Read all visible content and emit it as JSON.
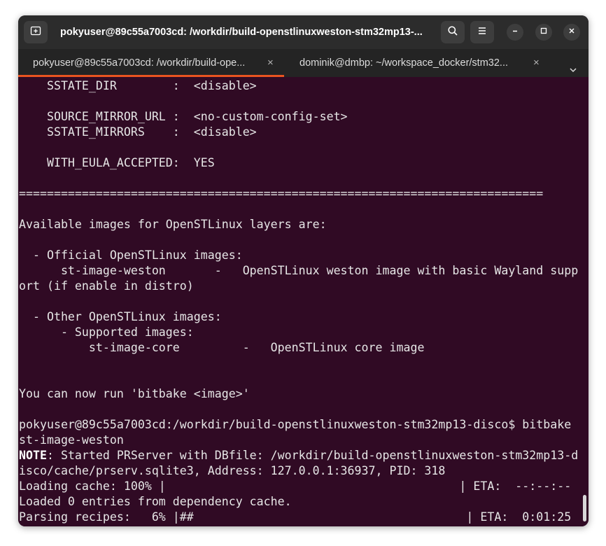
{
  "window": {
    "title": "pokyuser@89c55a7003cd: /workdir/build-openstlinuxweston-stm32mp13-..."
  },
  "tabs": [
    {
      "label": "pokyuser@89c55a7003cd: /workdir/build-ope...",
      "close": "×",
      "active": true
    },
    {
      "label": "dominik@dmbp: ~/workspace_docker/stm32...",
      "close": "×",
      "active": false
    }
  ],
  "icons": {
    "new_tab": "new-tab-icon",
    "search": "search-icon",
    "menu": "hamburger-menu-icon",
    "minimize": "minimize-icon",
    "maximize": "maximize-icon",
    "close": "close-icon",
    "tabs_dropdown": "chevron-down-icon"
  },
  "colors": {
    "terminal_bg": "#300a24",
    "titlebar_bg": "#2c2c2c",
    "tabbar_bg": "#242424",
    "active_tab_accent": "#e95420",
    "text": "#e6e6e6"
  },
  "terminal": {
    "lines": [
      "    SSTATE_DIR        :  <disable>",
      "",
      "    SOURCE_MIRROR_URL :  <no-custom-config-set>",
      "    SSTATE_MIRRORS    :  <disable>",
      "",
      "    WITH_EULA_ACCEPTED:  YES",
      "",
      "===========================================================================",
      "",
      "Available images for OpenSTLinux layers are:",
      "",
      "  - Official OpenSTLinux images:",
      "      st-image-weston       -   OpenSTLinux weston image with basic Wayland supp",
      "ort (if enable in distro)",
      "",
      "  - Other OpenSTLinux images:",
      "      - Supported images:",
      "          st-image-core         -   OpenSTLinux core image",
      "",
      "",
      "You can now run 'bitbake <image>'",
      "",
      "pokyuser@89c55a7003cd:/workdir/build-openstlinuxweston-stm32mp13-disco$ bitbake",
      "st-image-weston"
    ],
    "note_label": "NOTE",
    "note_line1": ": Started PRServer with DBfile: /workdir/build-openstlinuxweston-stm32mp13-d",
    "note_line2": "isco/cache/prserv.sqlite3, Address: 127.0.0.1:36937, PID: 318",
    "cache_line": "Loading cache: 100% |                                          | ETA:  --:--:--",
    "loaded_line": "Loaded 0 entries from dependency cache.",
    "parsing_line": "Parsing recipes:   6% |##                                       | ETA:  0:01:25"
  }
}
